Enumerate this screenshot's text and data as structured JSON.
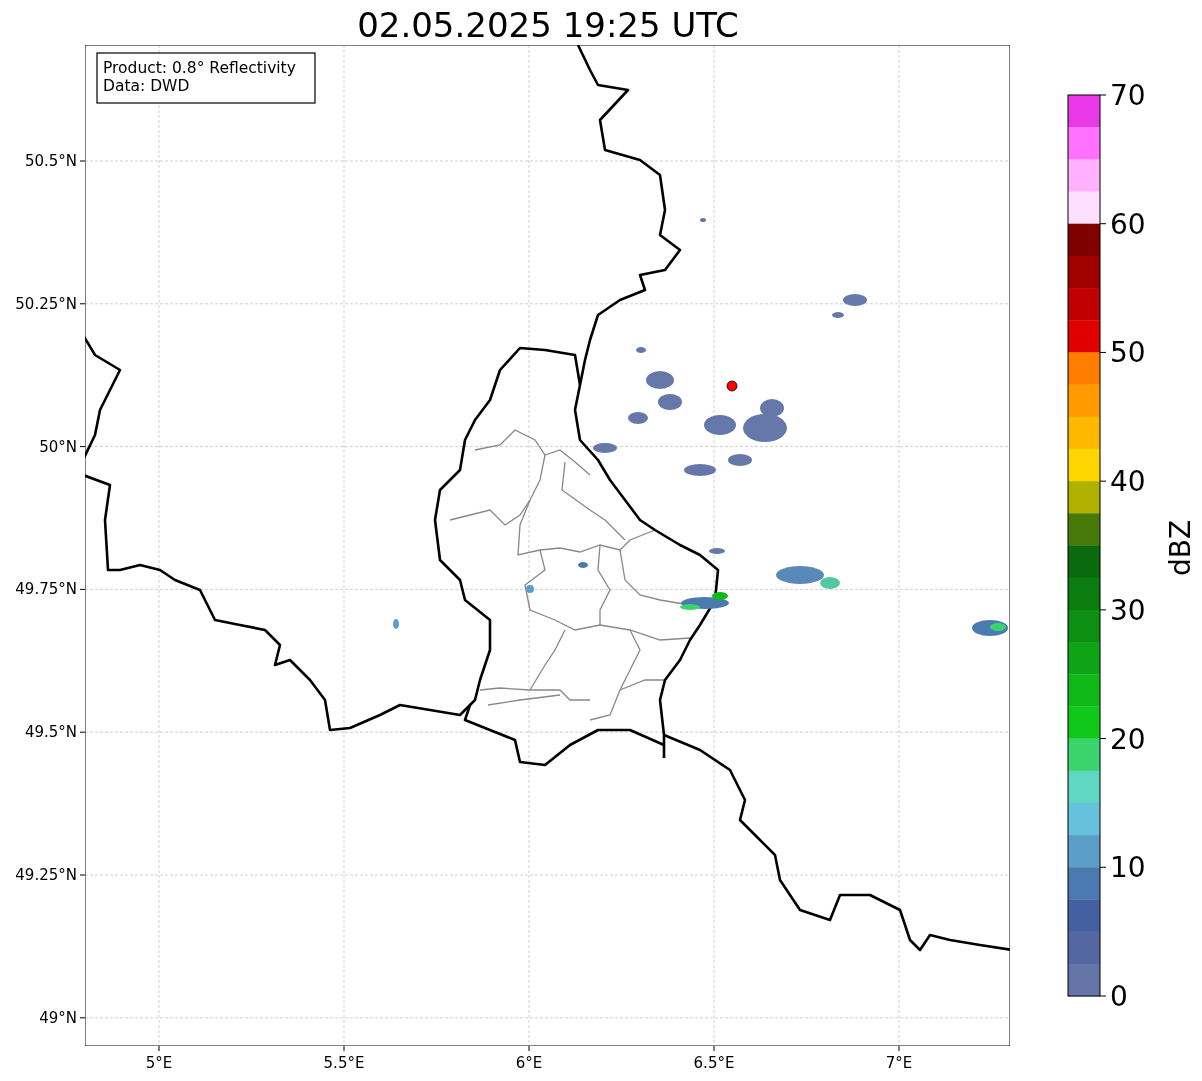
{
  "title": "02.05.2025 19:25 UTC",
  "info_box": [
    "Product: 0.8° Reflectivity",
    "Data: DWD"
  ],
  "map": {
    "yticks": [
      "50.5°N",
      "50.25°N",
      "50°N",
      "49.75°N",
      "49.5°N",
      "49.25°N",
      "49°N"
    ],
    "xticks": [
      "5°E",
      "5.5°E",
      "6°E",
      "6.5°E",
      "7°E"
    ]
  },
  "colorbar": {
    "label": "dBZ",
    "ticks": [
      "70",
      "60",
      "50",
      "40",
      "30",
      "20",
      "10",
      "0"
    ],
    "bins": [
      {
        "color": "#e838e8"
      },
      {
        "color": "#ff70ff"
      },
      {
        "color": "#ffb0ff"
      },
      {
        "color": "#ffdfff"
      },
      {
        "color": "#800000"
      },
      {
        "color": "#a00000"
      },
      {
        "color": "#c00000"
      },
      {
        "color": "#e00000"
      },
      {
        "color": "#ff7d00"
      },
      {
        "color": "#ff9a00"
      },
      {
        "color": "#ffb800"
      },
      {
        "color": "#ffd500"
      },
      {
        "color": "#b0b000"
      },
      {
        "color": "#487a0a"
      },
      {
        "color": "#0a6a0d"
      },
      {
        "color": "#0b7c10"
      },
      {
        "color": "#0d8f13"
      },
      {
        "color": "#0ea416"
      },
      {
        "color": "#10b818"
      },
      {
        "color": "#10c81a"
      },
      {
        "color": "#3bd46c"
      },
      {
        "color": "#5fd7c3"
      },
      {
        "color": "#66c1dc"
      },
      {
        "color": "#5b9ec7"
      },
      {
        "color": "#4a7ab0"
      },
      {
        "color": "#4460a3"
      },
      {
        "color": "#5567a1"
      },
      {
        "color": "#6675a8"
      }
    ]
  }
}
